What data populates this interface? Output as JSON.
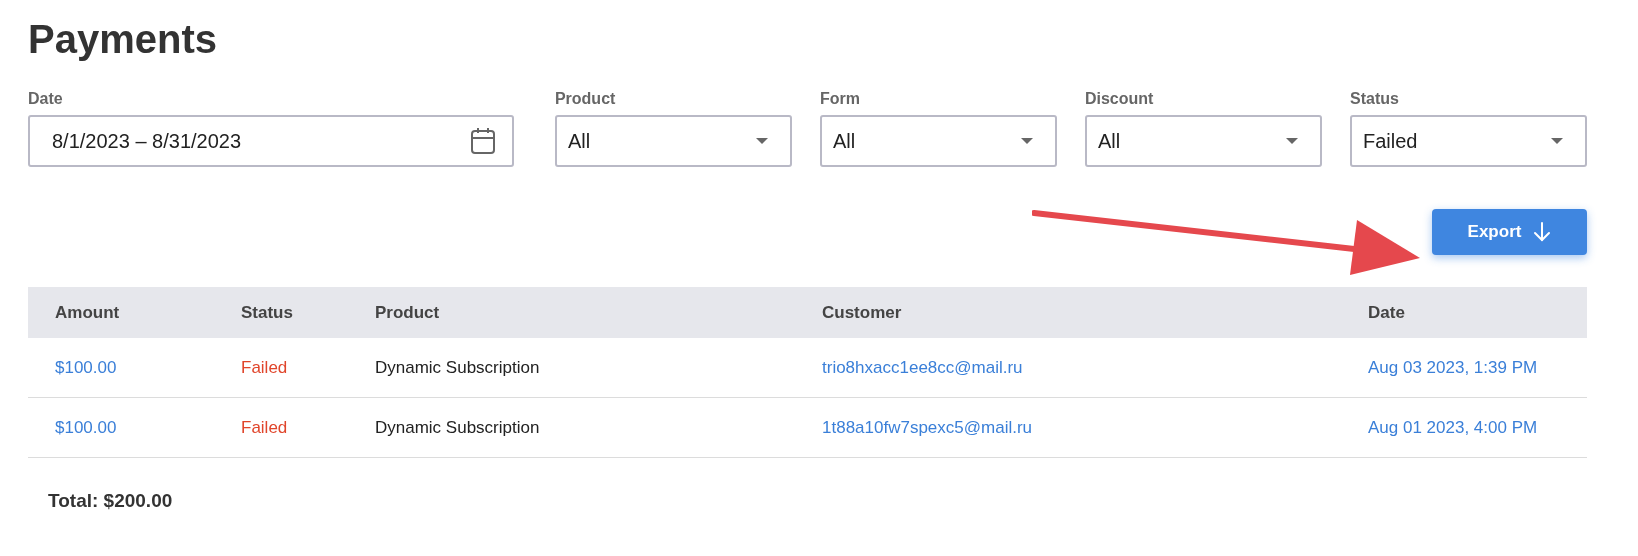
{
  "page": {
    "title": "Payments"
  },
  "filters": [
    {
      "label": "Date",
      "kind": "date",
      "value": "8/1/2023 – 8/31/2023"
    },
    {
      "label": "Product",
      "kind": "select",
      "value": "All"
    },
    {
      "label": "Form",
      "kind": "select",
      "value": "All"
    },
    {
      "label": "Discount",
      "kind": "select",
      "value": "All"
    },
    {
      "label": "Status",
      "kind": "select",
      "value": "Failed"
    }
  ],
  "export_button": {
    "label": "Export"
  },
  "table": {
    "columns": [
      "Amount",
      "Status",
      "Product",
      "Customer",
      "Date"
    ],
    "rows": [
      {
        "amount": "$100.00",
        "status": {
          "text": "Failed",
          "color": "#e0452b"
        },
        "product": "Dynamic Subscription",
        "customer": "trio8hxacc1ee8cc@mail.ru",
        "date": "Aug 03 2023, 1:39 PM"
      },
      {
        "amount": "$100.00",
        "status": {
          "text": "Failed",
          "color": "#e0452b"
        },
        "product": "Dynamic Subscription",
        "customer": "1t88a10fw7spexc5@mail.ru",
        "date": "Aug 01 2023, 4:00 PM"
      }
    ]
  },
  "total": "Total: $200.00"
}
